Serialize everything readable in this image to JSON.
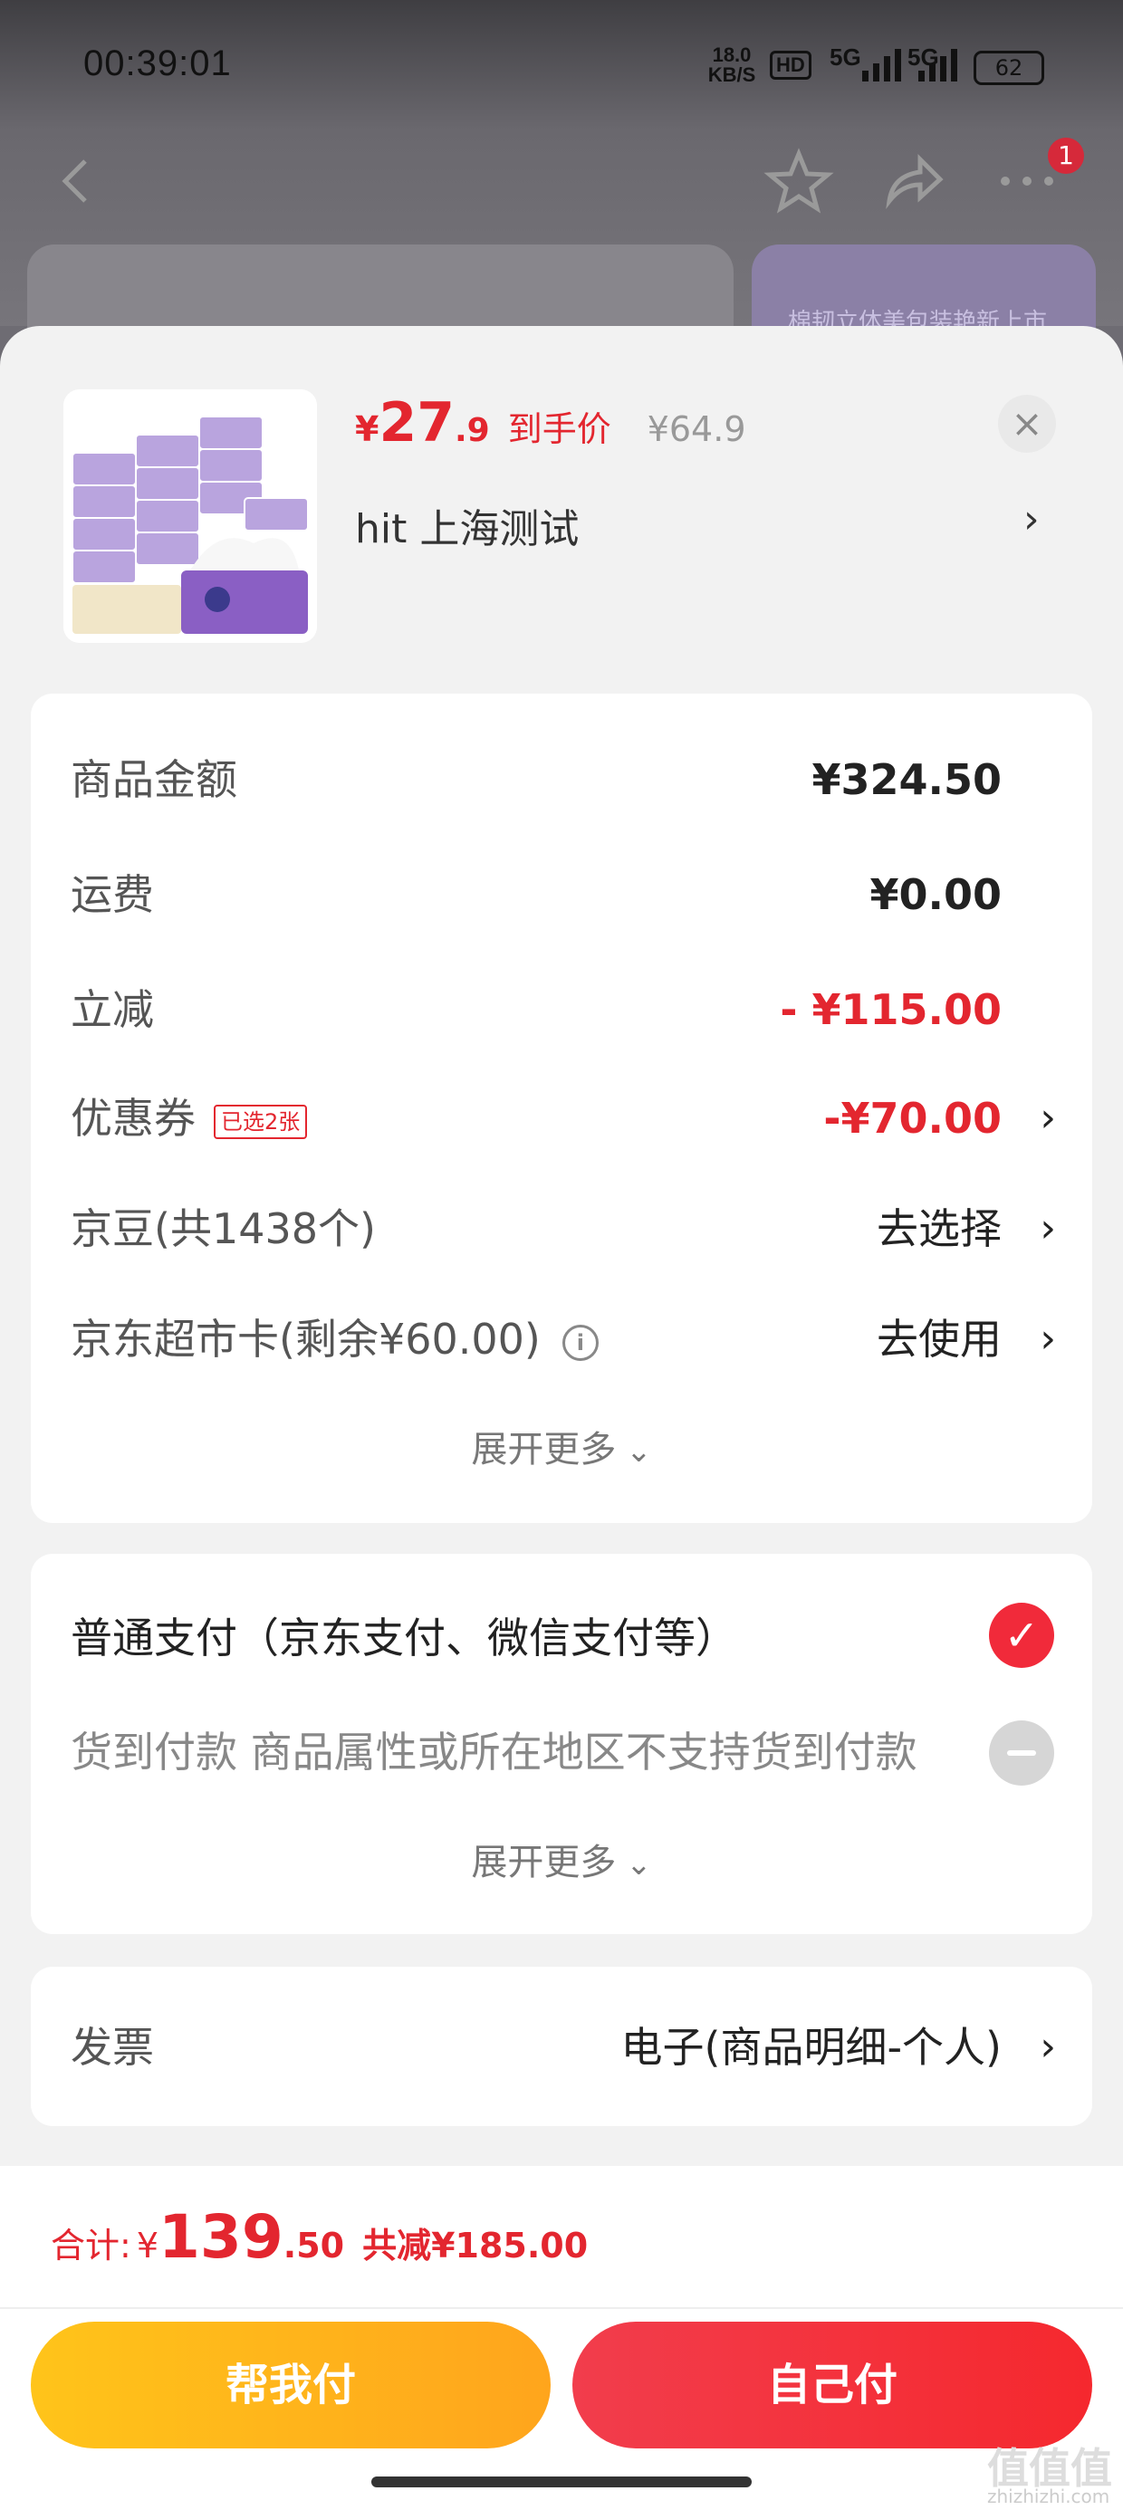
{
  "status_bar": {
    "time": "00:39:01",
    "network_speed": "18.0 KB/S",
    "hd": "HD",
    "sig1": "5G",
    "sig2": "5G",
    "battery": "62"
  },
  "nav": {
    "back_icon": "chevron-left-icon",
    "favorite_icon": "star-icon",
    "share_icon": "share-icon",
    "more_icon": "more-dots-icon",
    "notification_count": "1"
  },
  "background_page": {
    "banner_text": "棉韧立体美包装艳新上市"
  },
  "product": {
    "price_yen": "¥",
    "price_int": "27",
    "price_dec": ".9",
    "price_tag": "到手价",
    "original_price": "¥64.9",
    "address": "hit 上海测试"
  },
  "cost_summary": {
    "rows": [
      {
        "label": "商品金额",
        "value": "¥324.50"
      },
      {
        "label": "运费",
        "value": "¥0.00"
      },
      {
        "label": "立减",
        "value": "- ¥115.00"
      },
      {
        "label": "优惠券",
        "tag": "已选2张",
        "value": "-¥70.00"
      },
      {
        "label": "京豆(共1438个)",
        "value": "去选择"
      },
      {
        "label": "京东超市卡(剩余¥60.00)",
        "value": "去使用"
      }
    ],
    "expand_label": "展开更多"
  },
  "payment": {
    "option_normal": "普通支付（京东支付、微信支付等）",
    "option_cod": "货到付款 商品属性或所在地区不支持货到付款",
    "expand_label": "展开更多"
  },
  "invoice": {
    "label": "发票",
    "value": "电子(商品明细-个人)"
  },
  "footer": {
    "total_label": "合计:",
    "total_yen": "¥",
    "total_int": "139",
    "total_dec": ".50",
    "total_saving": "共减¥185.00",
    "help_pay_label": "帮我付",
    "self_pay_label": "自己付"
  },
  "watermark": {
    "text": "值值值",
    "domain": "zhizhizhi.com"
  },
  "colors": {
    "accent_red": "#e3262f",
    "help_button": "#ffb31b",
    "self_button": "#f23340"
  }
}
